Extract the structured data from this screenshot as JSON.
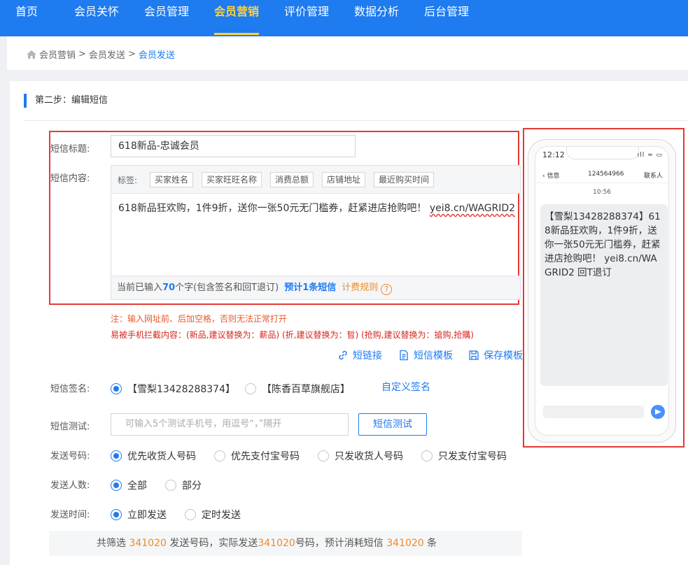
{
  "nav": {
    "items": [
      {
        "label": "首页",
        "active": false
      },
      {
        "label": "会员关怀",
        "active": false
      },
      {
        "label": "会员管理",
        "active": false
      },
      {
        "label": "会员营销",
        "active": true
      },
      {
        "label": "评价管理",
        "active": false
      },
      {
        "label": "数据分析",
        "active": false
      },
      {
        "label": "后台管理",
        "active": false
      }
    ]
  },
  "breadcrumb": {
    "part1": "会员营销",
    "sep1": " > ",
    "part2": "会员发送",
    "sep2": " > ",
    "current": "会员发送"
  },
  "step": {
    "title": "第二步：编辑短信"
  },
  "form": {
    "title_label": "短信标题:",
    "title_value": "618新品-忠诚会员",
    "content_label": "短信内容:",
    "tags_label": "标签:",
    "tags": [
      "买家姓名",
      "买家旺旺名称",
      "消费总额",
      "店铺地址",
      "最近购买时间"
    ],
    "content_text": "618新品狂欢购，1件9折，送你一张50元无门槛券，赶紧进店抢购吧！ ",
    "content_link": "yei8.cn/WAGRID2",
    "count_prefix": "当前已输入",
    "count_num": "70",
    "count_suffix": "个字(包含签名和回T退订)",
    "sms_total": "预计1条短信",
    "fee_rule": "计费规则",
    "fee_help": "?",
    "note1": "注：输入网址前、后加空格，否则无法正常打开",
    "note2": "易被手机拦截内容：(新品,建议替换为：薪品) (折,建议替换为：晢) (抢购,建议替换为：搶购,抢購)",
    "tools": {
      "short_link": "短链接",
      "template": "短信模板",
      "save_template": "保存模板"
    },
    "signature_label": "短信签名:",
    "signatures": [
      {
        "label": "【雪梨13428288374】",
        "checked": true
      },
      {
        "label": "【陈香百草旗舰店】",
        "checked": false
      }
    ],
    "custom_signature": "自定义签名",
    "test_label": "短信测试:",
    "test_placeholder": "可输入5个测试手机号，用逗号“，”隔开",
    "test_button": "短信测试",
    "number_label": "发送号码:",
    "number_options": [
      {
        "label": "优先收货人号码",
        "checked": true
      },
      {
        "label": "优先支付宝号码",
        "checked": false
      },
      {
        "label": "只发收货人号码",
        "checked": false
      },
      {
        "label": "只发支付宝号码",
        "checked": false
      }
    ],
    "people_label": "发送人数:",
    "people_options": [
      {
        "label": "全部",
        "checked": true
      },
      {
        "label": "部分",
        "checked": false
      }
    ],
    "time_label": "发送时间:",
    "time_options": [
      {
        "label": "立即发送",
        "checked": true
      },
      {
        "label": "定时发送",
        "checked": false
      }
    ]
  },
  "summary": {
    "p1": "共筛选 ",
    "n1": "341020",
    "p2": " 发送号码，实际发送",
    "n2": "341020",
    "p3": "号码，预计消耗短信 ",
    "n3": "341020",
    "p4": " 条"
  },
  "phone": {
    "time": "12:12",
    "status": "ıll ≈ ▭",
    "back": "‹ 信息",
    "number": "124564966",
    "contact": "联系人",
    "msg_time": "10:56",
    "message": "【雪梨13428288374】618新品狂欢购，1件9折，送你一张50元无门槛券，赶紧进店抢购吧！ yei8.cn/WAGRID2 回T退订"
  },
  "colors": {
    "primary": "#1e7bf0",
    "active_nav": "#ffd23a",
    "highlight_box": "#e53935",
    "orange": "#f08a24"
  }
}
